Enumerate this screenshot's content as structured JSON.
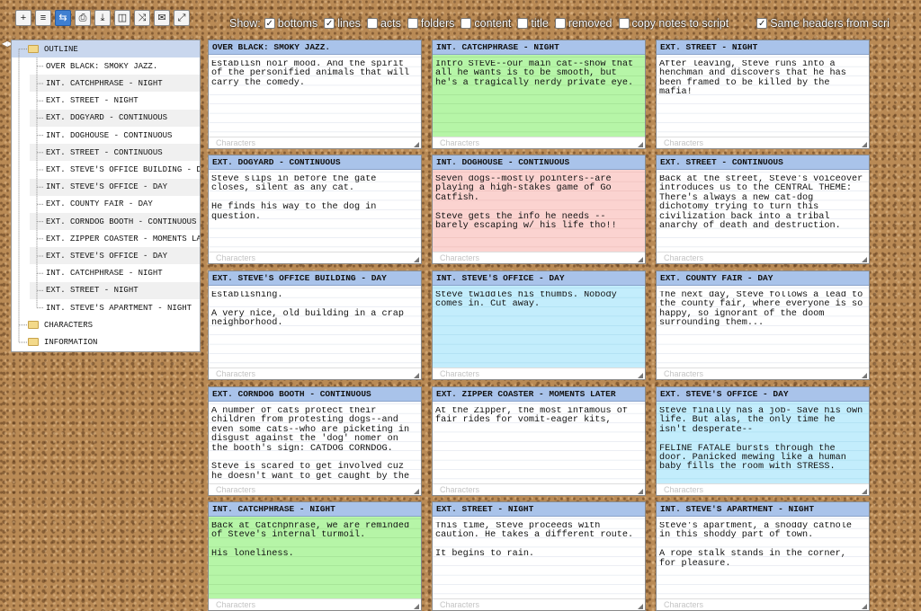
{
  "toolbar": {
    "buttons": [
      {
        "name": "add-card-button",
        "icon": "plus-icon",
        "glyph": "+"
      },
      {
        "name": "list-view-button",
        "icon": "list-icon",
        "glyph": "≡"
      },
      {
        "name": "swap-button",
        "icon": "swap-arrows-icon",
        "glyph": "⇆"
      },
      {
        "name": "print-button",
        "icon": "printer-icon",
        "glyph": "⎙"
      },
      {
        "name": "download-button",
        "icon": "download-icon",
        "glyph": "⤓"
      },
      {
        "name": "columns-button",
        "icon": "columns-icon",
        "glyph": "◫"
      },
      {
        "name": "shuffle-button",
        "icon": "shuffle-icon",
        "glyph": "⤨"
      },
      {
        "name": "email-button",
        "icon": "envelope-icon",
        "glyph": "✉"
      },
      {
        "name": "fullscreen-button",
        "icon": "fullscreen-icon",
        "glyph": "⤢"
      }
    ],
    "active_button": "swap-button"
  },
  "show": {
    "label": "Show:",
    "options": [
      {
        "name": "show-bottoms",
        "label": "bottoms",
        "checked": true
      },
      {
        "name": "show-lines",
        "label": "lines",
        "checked": true
      },
      {
        "name": "show-acts",
        "label": "acts",
        "checked": false
      },
      {
        "name": "show-folders",
        "label": "folders",
        "checked": false
      },
      {
        "name": "show-content",
        "label": "content",
        "checked": false
      },
      {
        "name": "show-title",
        "label": "title",
        "checked": false
      },
      {
        "name": "show-removed",
        "label": "removed",
        "checked": false
      },
      {
        "name": "copy-notes",
        "label": "copy notes to script",
        "checked": false
      }
    ],
    "same_headers": {
      "label": "Same headers from scri",
      "checked": true
    }
  },
  "outline": {
    "root_label": "OUTLINE",
    "children": [
      "OVER BLACK: SMOKY JAZZ.",
      "INT. CATCHPHRASE - NIGHT",
      "EXT. STREET - NIGHT",
      "EXT. DOGYARD - CONTINUOUS",
      "INT. DOGHOUSE - CONTINUOUS",
      "EXT. STREET - CONTINUOUS",
      "EXT. STEVE'S OFFICE BUILDING - DAY",
      "INT. STEVE'S OFFICE - DAY",
      "EXT. COUNTY FAIR - DAY",
      "EXT. CORNDOG BOOTH - CONTINUOUS",
      "EXT. ZIPPER COASTER - MOMENTS LATER",
      "EXT. STEVE'S OFFICE - DAY",
      "INT. CATCHPHRASE - NIGHT",
      "EXT. STREET - NIGHT",
      "INT. STEVE'S APARTMENT - NIGHT"
    ],
    "other_folders": [
      "CHARACTERS",
      "INFORMATION"
    ]
  },
  "card_footer_placeholder": "Characters",
  "colors": {
    "white": "#ffffff",
    "green": "#b6f5a7",
    "pink": "#fbd3d0",
    "blue": "#c3edfc",
    "header": "#a9c3ea"
  },
  "cards": [
    {
      "title": "OVER BLACK: SMOKY JAZZ.",
      "color": "white",
      "paragraphs": [
        "Establish noir mood. And the spirit of the personified animals that will carry the comedy."
      ]
    },
    {
      "title": "INT. CATCHPHRASE - NIGHT",
      "color": "green",
      "paragraphs": [
        "Intro STEVE--our main cat--show that all he wants is to be smooth, but he's a tragically nerdy private eye."
      ]
    },
    {
      "title": "EXT. STREET - NIGHT",
      "color": "white",
      "paragraphs": [
        "After leaving, Steve runs into a henchman and discovers that he has been framed to be killed by the mafia!"
      ]
    },
    {
      "title": "EXT. DOGYARD - CONTINUOUS",
      "color": "white",
      "paragraphs": [
        "Steve slips in before the gate closes, silent as any cat.",
        "He finds his way to the dog in question."
      ]
    },
    {
      "title": "INT. DOGHOUSE - CONTINUOUS",
      "color": "pink",
      "paragraphs": [
        "Seven dogs--mostly pointers--are playing a high-stakes game of Go Catfish.",
        "Steve gets the info he needs -- barely escaping w/ his life tho!!"
      ]
    },
    {
      "title": "EXT. STREET - CONTINUOUS",
      "color": "white",
      "paragraphs": [
        "Back at the street, Steve's voiceover introduces us to the CENTRAL THEME: There's always a new cat-dog dichotomy trying to turn this civilization back into a tribal anarchy of death and destruction."
      ]
    },
    {
      "title": "EXT. STEVE'S OFFICE BUILDING - DAY",
      "color": "white",
      "paragraphs": [
        "Establishing.",
        "A very nice, old building in a crap neighborhood."
      ]
    },
    {
      "title": "INT. STEVE'S OFFICE - DAY",
      "color": "blue",
      "paragraphs": [
        "Steve twiddles his thumbs. Nobody comes in. Cut away."
      ]
    },
    {
      "title": "EXT. COUNTY FAIR - DAY",
      "color": "white",
      "paragraphs": [
        "The next day, Steve follows a lead to the county fair, where everyone is so happy, so ignorant of the doom surrounding them..."
      ]
    },
    {
      "title": "EXT. CORNDOG BOOTH - CONTINUOUS",
      "color": "white",
      "paragraphs": [
        "A number of cats protect their children from protesting dogs--and even some cats--who are picketing in disgust against the 'dog' nomer on the booth's sign: CATDOG CORNDOG.",
        "Steve is scared to get involved cuz he doesn't want to get caught by the"
      ]
    },
    {
      "title": "EXT. ZIPPER COASTER - MOMENTS LATER",
      "color": "white",
      "paragraphs": [
        "At the Zipper, the most infamous of fair rides for vomit-eager kits,"
      ]
    },
    {
      "title": "EXT. STEVE'S OFFICE - DAY",
      "color": "blue",
      "paragraphs": [
        "Steve finally has a job- Save his own life. But alas, the only time he isn't desperate--",
        "FELINE FATALE bursts through the door. Panicked mewing like a human baby fills the room with STRESS."
      ]
    },
    {
      "title": "INT. CATCHPHRASE - NIGHT",
      "color": "green",
      "paragraphs": [
        "Back at Catchphrase, we are reminded of Steve's internal turmoil.",
        "His loneliness."
      ]
    },
    {
      "title": "EXT. STREET - NIGHT",
      "color": "white",
      "paragraphs": [
        "This time, Steve proceeds with caution. He takes a different route.",
        "It begins to rain."
      ]
    },
    {
      "title": "INT. STEVE'S APARTMENT - NIGHT",
      "color": "white",
      "paragraphs": [
        "Steve's apartment, a shoddy cathole in this shoddy part of town.",
        "A rope stalk stands in the corner, for pleasure."
      ]
    }
  ]
}
